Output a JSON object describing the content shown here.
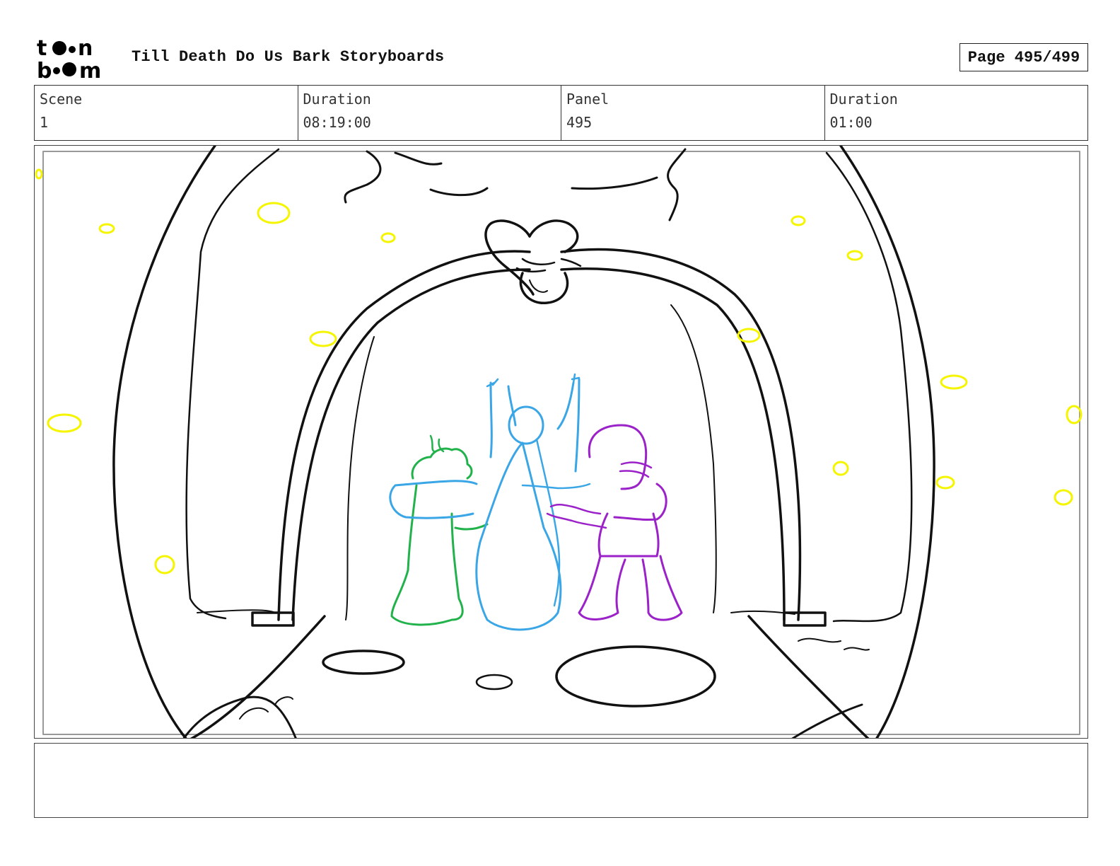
{
  "header": {
    "logo_text_top": "toon",
    "logo_text_bottom": "boom",
    "title": "Till Death Do Us Bark Storyboards",
    "page_label": "Page 495/499"
  },
  "info": [
    {
      "label": "Scene",
      "value": "1"
    },
    {
      "label": "Duration",
      "value": "08:19:00"
    },
    {
      "label": "Panel",
      "value": "495"
    },
    {
      "label": "Duration",
      "value": "01:00"
    }
  ],
  "sketch": {
    "line_color": "#111111",
    "sparkle_color": "#f5f500",
    "character_colors": {
      "green": "#22b24c",
      "blue": "#3aa6e6",
      "purple": "#9b22c8"
    }
  },
  "notes": {
    "text": ""
  }
}
